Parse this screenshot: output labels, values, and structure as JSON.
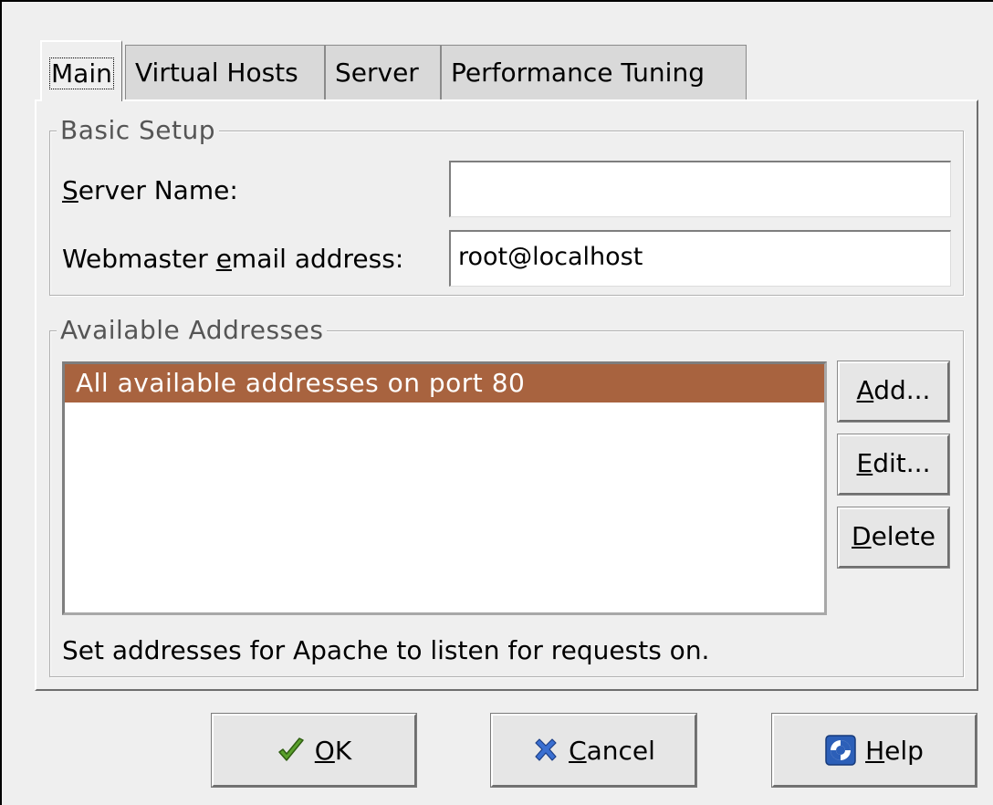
{
  "tabs": [
    {
      "label": "Main",
      "active": true
    },
    {
      "label": "Virtual Hosts"
    },
    {
      "label": "Server"
    },
    {
      "label": "Performance Tuning"
    }
  ],
  "basic_setup": {
    "legend": "Basic Setup",
    "server_name": {
      "label_mnemonic": "S",
      "label_rest": "erver Name:",
      "value": ""
    },
    "webmaster_email": {
      "label_pre": "Webmaster ",
      "label_mnemonic": "e",
      "label_rest": "mail address:",
      "value": "root@localhost"
    }
  },
  "available_addresses": {
    "legend": "Available Addresses",
    "items": [
      "All available addresses on port 80"
    ],
    "selected_color": "#a8633f",
    "add_button": {
      "mnemonic": "A",
      "rest": "dd..."
    },
    "edit_button": {
      "mnemonic": "E",
      "rest": "dit..."
    },
    "delete_button": {
      "mnemonic": "D",
      "rest": "elete"
    },
    "hint": "Set addresses for Apache to listen for requests on."
  },
  "dialog_buttons": {
    "ok": {
      "mnemonic": "O",
      "rest": "K",
      "icon": "checkmark-icon"
    },
    "cancel": {
      "mnemonic": "C",
      "rest": "ancel",
      "icon": "x-icon"
    },
    "help": {
      "mnemonic": "H",
      "rest": "elp",
      "icon": "lifebuoy-icon"
    }
  }
}
